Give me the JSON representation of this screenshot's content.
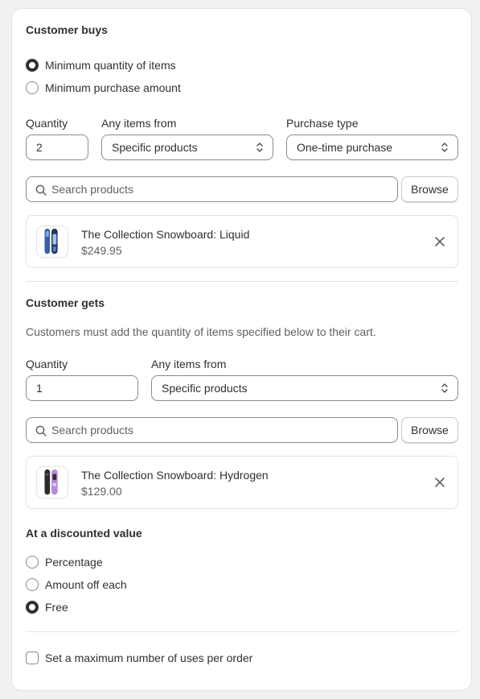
{
  "buys": {
    "heading": "Customer buys",
    "options": [
      "Minimum quantity of items",
      "Minimum purchase amount"
    ],
    "selected_index": 0,
    "quantity_label": "Quantity",
    "quantity_value": "2",
    "items_from_label": "Any items from",
    "items_from_value": "Specific products",
    "purchase_type_label": "Purchase type",
    "purchase_type_value": "One-time purchase",
    "search_placeholder": "Search products",
    "browse_label": "Browse",
    "product": {
      "name": "The Collection Snowboard: Liquid",
      "price": "$249.95"
    }
  },
  "gets": {
    "heading": "Customer gets",
    "description": "Customers must add the quantity of items specified below to their cart.",
    "quantity_label": "Quantity",
    "quantity_value": "1",
    "items_from_label": "Any items from",
    "items_from_value": "Specific products",
    "search_placeholder": "Search products",
    "browse_label": "Browse",
    "product": {
      "name": "The Collection Snowboard: Hydrogen",
      "price": "$129.00"
    }
  },
  "discount": {
    "heading": "At a discounted value",
    "options": [
      "Percentage",
      "Amount off each",
      "Free"
    ],
    "selected_index": 2
  },
  "max_uses": {
    "label": "Set a maximum number of uses per order",
    "checked": false
  },
  "colors": {
    "card_bg": "#ffffff",
    "page_bg": "#f1f1f1",
    "text": "#303030",
    "subdued": "#616161",
    "border": "#8a8a8a"
  }
}
